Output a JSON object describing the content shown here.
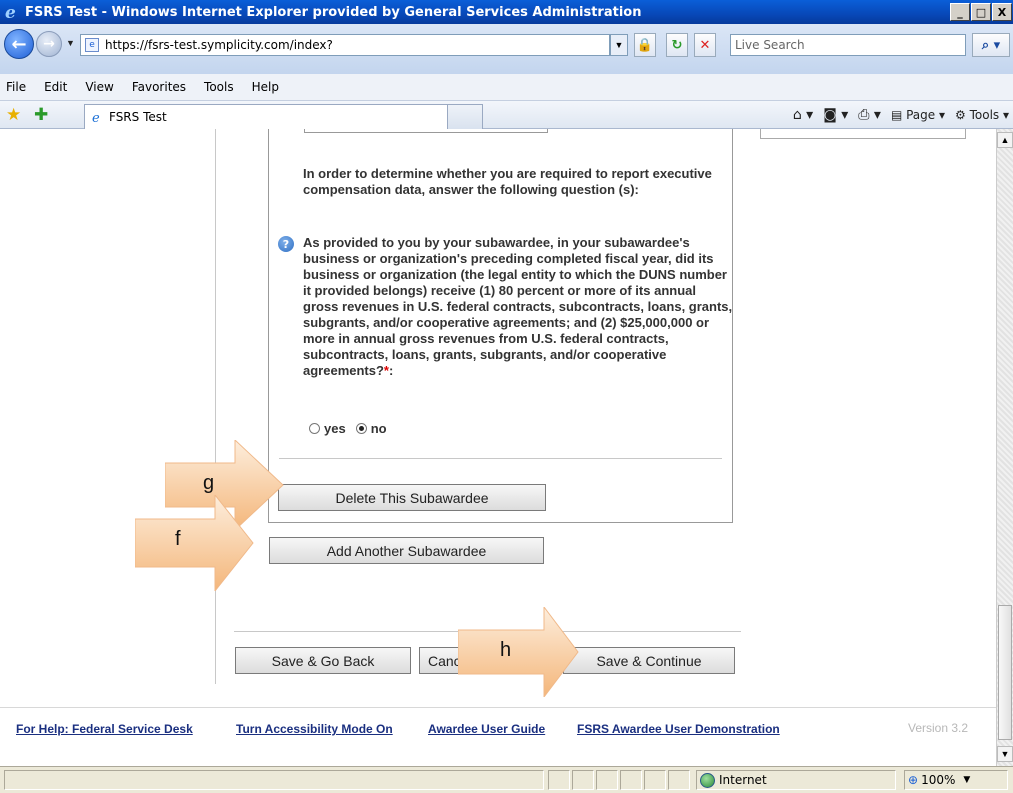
{
  "window": {
    "title": "FSRS Test - Windows Internet Explorer provided by General Services Administration",
    "min": "_",
    "max": "□",
    "close": "X"
  },
  "address": {
    "url": "https://fsrs-test.symplicity.com/index?",
    "search_placeholder": "Live Search"
  },
  "menu": [
    "File",
    "Edit",
    "View",
    "Favorites",
    "Tools",
    "Help"
  ],
  "tab": {
    "title": "FSRS Test"
  },
  "commands": {
    "page": "Page",
    "tools": "Tools"
  },
  "form": {
    "intro": "In order to determine whether you are required to report executive compensation data, answer the following question (s):",
    "question": "As provided to you by your subawardee, in your subawardee's business or organization's preceding completed fiscal year, did its business or organization (the legal entity to which the DUNS number it provided belongs) receive (1) 80 percent or more of its annual gross revenues in U.S. federal contracts, subcontracts, loans, grants, subgrants, and/or cooperative agreements; and (2) $25,000,000 or more in annual gross revenues from U.S. federal contracts, subcontracts, loans, grants, subgrants, and/or cooperative agreements?",
    "required_mark": "*",
    "colon": ":",
    "options": {
      "yes": "yes",
      "no": "no",
      "selected": "no"
    },
    "delete_button": "Delete This Subawardee",
    "add_button": "Add Another Subawardee"
  },
  "actions": {
    "save_back": "Save & Go Back",
    "cancel": "Canc",
    "save_continue": "Save & Continue"
  },
  "callouts": {
    "g": "g",
    "f": "f",
    "h": "h"
  },
  "footer": {
    "help": "For Help: Federal Service Desk",
    "accessibility": "Turn Accessibility Mode On",
    "guide": "Awardee User Guide",
    "demo": "FSRS Awardee User Demonstration",
    "version": "Version 3.2"
  },
  "status": {
    "zone": "Internet",
    "zoom": "100%"
  }
}
